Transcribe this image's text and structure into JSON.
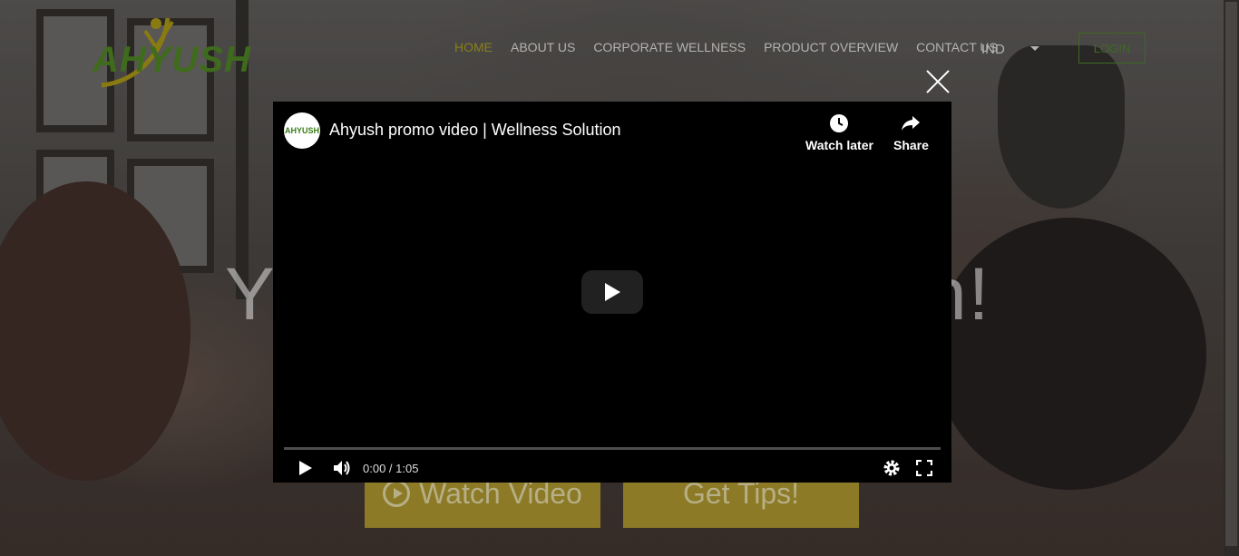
{
  "header": {
    "logo_text": "AHYUSH",
    "nav": [
      {
        "label": "HOME",
        "active": true
      },
      {
        "label": "ABOUT US",
        "active": false
      },
      {
        "label": "CORPORATE WELLNESS",
        "active": false
      },
      {
        "label": "PRODUCT OVERVIEW",
        "active": false
      },
      {
        "label": "CONTACT US",
        "active": false
      }
    ],
    "language": "IND",
    "login_label": "LOGIN"
  },
  "hero": {
    "heading_left": "Y",
    "heading_right": "n!",
    "watch_video_label": "Watch Video",
    "get_tips_label": "Get Tips!"
  },
  "video_modal": {
    "channel_avatar_text": "AHYUSH",
    "title": "Ahyush promo video | Wellness Solution",
    "watch_later_label": "Watch later",
    "share_label": "Share",
    "time_display": "0:00 / 1:05",
    "progress_fraction": 0
  },
  "colors": {
    "nav_active": "#8a7f1a",
    "brand_green": "#3e6a22",
    "cta_gold": "#8c7a26"
  }
}
